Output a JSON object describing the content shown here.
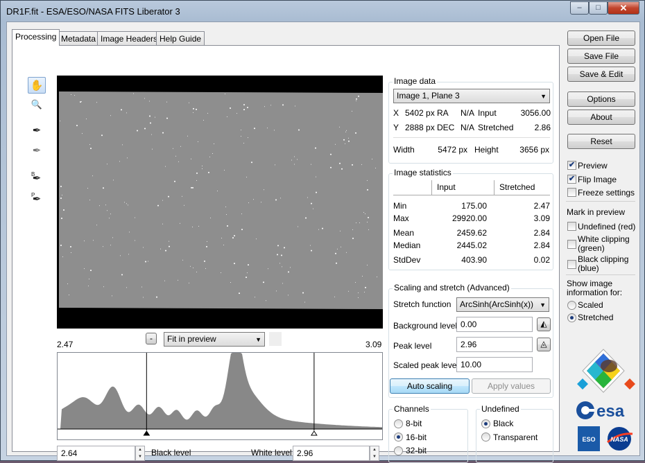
{
  "window": {
    "title": "DR1F.fit - ESA/ESO/NASA FITS Liberator 3",
    "min": "–",
    "max": "□",
    "close": "✕"
  },
  "tabs": [
    {
      "label": "Processing",
      "active": true
    },
    {
      "label": "Metadata"
    },
    {
      "label": "Image Headers"
    },
    {
      "label": "Help Guide"
    }
  ],
  "tools": {
    "hand": "✋",
    "zoom": "🔍",
    "picker1": "✒",
    "picker2": "✒",
    "picker_b": "✒",
    "picker_p": "✒",
    "b": "B",
    "p": "P"
  },
  "preview": {
    "zoom_minus": "-",
    "zoom_option": "Fit in preview",
    "scale_min": "2.47",
    "scale_max": "3.09"
  },
  "histogram": {
    "black_level": 2.64,
    "white_level": 2.96,
    "range_min": 2.47,
    "range_max": 3.09
  },
  "levels": {
    "black_value": "2.64",
    "black_label": "Black level",
    "white_label": "White level",
    "white_value": "2.96",
    "up": "▲",
    "down": "▼"
  },
  "image_data": {
    "title": "Image data",
    "plane": "Image 1, Plane 3",
    "x_label": "X",
    "x_value": "5402 px",
    "ra_label": "RA",
    "ra_value": "N/A",
    "input_label": "Input",
    "input_value": "3056.00",
    "y_label": "Y",
    "y_value": "2888 px",
    "dec_label": "DEC",
    "dec_value": "N/A",
    "stretched_label": "Stretched",
    "stretched_value": "2.86",
    "width_label": "Width",
    "width_value": "5472 px",
    "height_label": "Height",
    "height_value": "3656 px"
  },
  "stats": {
    "title": "Image statistics",
    "col_input": "Input",
    "col_stretched": "Stretched",
    "rows": [
      {
        "label": "Min",
        "input": "175.00",
        "stretched": "2.47"
      },
      {
        "label": "Max",
        "input": "29920.00",
        "stretched": "3.09"
      },
      {
        "label": "Mean",
        "input": "2459.62",
        "stretched": "2.84"
      },
      {
        "label": "Median",
        "input": "2445.02",
        "stretched": "2.84"
      },
      {
        "label": "StdDev",
        "input": "403.90",
        "stretched": "0.02"
      }
    ]
  },
  "scaling": {
    "title": "Scaling and stretch (Advanced)",
    "stretch_label": "Stretch function",
    "stretch_value": "ArcSinh(ArcSinh(x))",
    "background_label": "Background level",
    "background_value": "0.00",
    "peak_label": "Peak level",
    "peak_value": "2.96",
    "scaled_peak_label": "Scaled peak level",
    "scaled_peak_value": "10.00",
    "auto_button": "Auto scaling",
    "apply_button": "Apply values"
  },
  "channels": {
    "title": "Channels",
    "options": [
      "8-bit",
      "16-bit",
      "32-bit"
    ],
    "selected": "16-bit"
  },
  "undefined": {
    "title": "Undefined",
    "options": [
      "Black",
      "Transparent"
    ],
    "selected": "Black"
  },
  "buttons": {
    "open": "Open File",
    "save": "Save File",
    "save_edit": "Save & Edit",
    "options": "Options",
    "about": "About",
    "reset": "Reset"
  },
  "checks": {
    "preview": "Preview",
    "flip": "Flip Image",
    "freeze": "Freeze settings",
    "check": "✔"
  },
  "mark": {
    "title": "Mark in preview",
    "undefined": "Undefined (red)",
    "white1": "White clipping",
    "white2": "(green)",
    "black1": "Black clipping",
    "black2": "(blue)"
  },
  "show_info": {
    "title1": "Show image",
    "title2": "information for:",
    "scaled": "Scaled",
    "stretched": "Stretched"
  },
  "logos": {
    "esa": "esa",
    "eso": "ESO",
    "nasa": "NASA"
  },
  "colors": {
    "accent": "#1c3c7c",
    "histogram_fill": "#888888",
    "preview_gray": "#8e8e8e"
  }
}
